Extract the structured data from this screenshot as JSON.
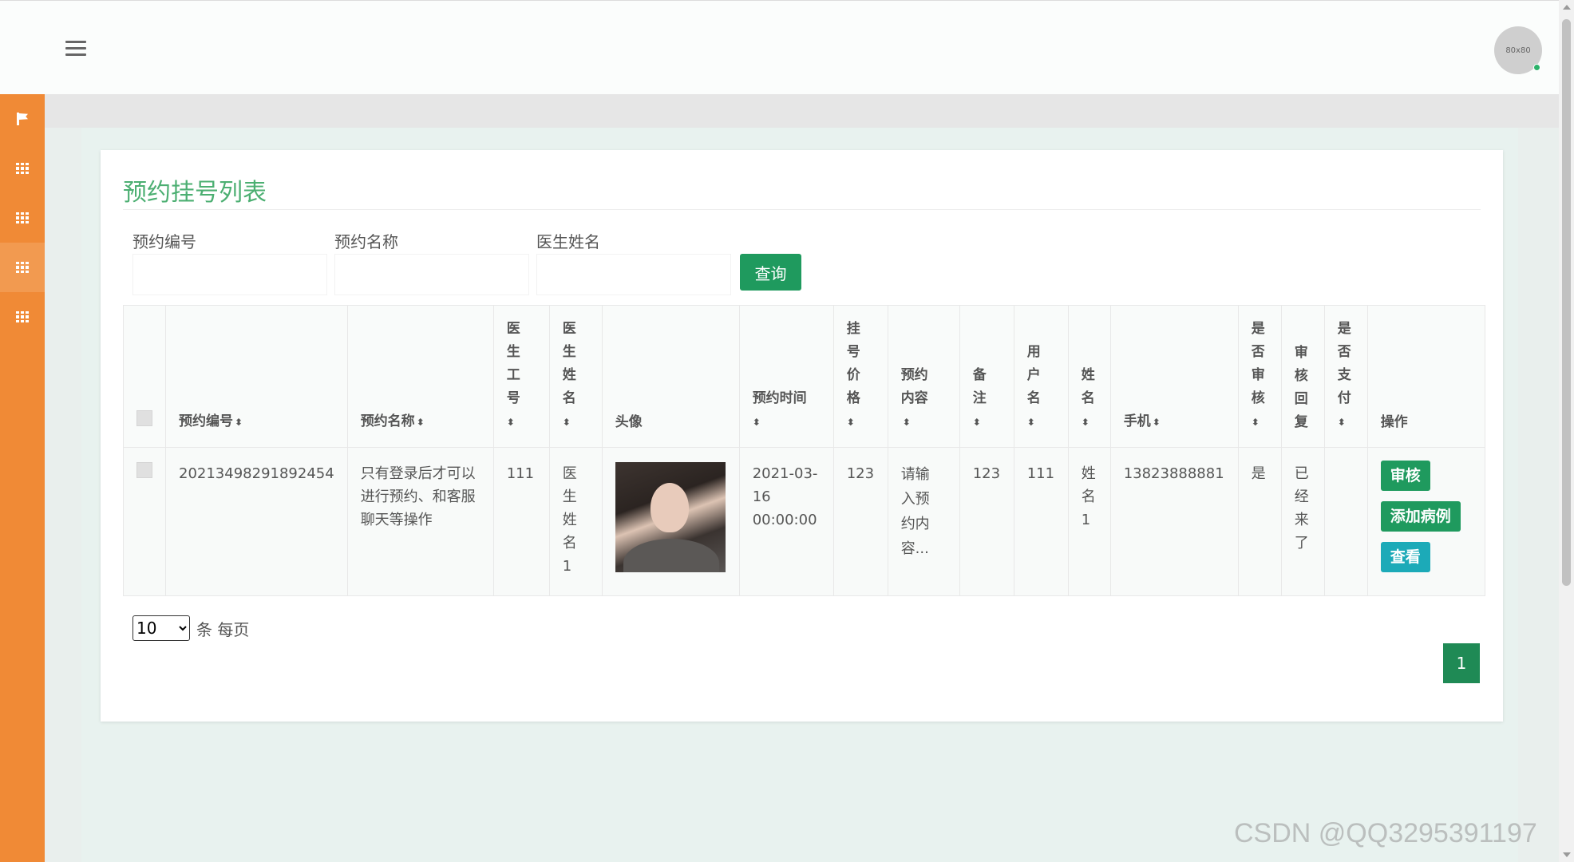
{
  "topbar": {
    "avatar_text": "80x80"
  },
  "sidebar": {
    "items": [
      "flag-icon",
      "grid-icon",
      "grid-icon",
      "grid-icon",
      "grid-icon"
    ],
    "accent": "#f08a36"
  },
  "panel": {
    "title": "预约挂号列表"
  },
  "search": {
    "fields": [
      {
        "label": "预约编号",
        "value": ""
      },
      {
        "label": "预约名称",
        "value": ""
      },
      {
        "label": "医生姓名",
        "value": ""
      }
    ],
    "button": "查询"
  },
  "table": {
    "headers": {
      "h1": "预约编号",
      "h2": "预约名称",
      "h3": "医生工号",
      "h4": "医生姓名",
      "h5": "头像",
      "h6": "预约时间",
      "h7": "挂号价格",
      "h8": "预约内容",
      "h9": "备注",
      "h10": "用户名",
      "h11": "姓名",
      "h12": "手机",
      "h13": "是否审核",
      "h14": "审核回复",
      "h15": "是否支付",
      "h16": "操作"
    },
    "row": {
      "c1": "20213498291892454",
      "c2": "只有登录后才可以进行预约、和客服聊天等操作",
      "c3": "111",
      "c4": "医生姓名1",
      "c6": "2021-03-16 00:00:00",
      "c7": "123",
      "c8": "请输入预约内容...",
      "c9": "123",
      "c10": "111",
      "c11": "姓名1",
      "c12": "13823888881",
      "c13": "是",
      "c14": "已经来了",
      "c15": ""
    },
    "actions": {
      "review": "审核",
      "add_case": "添加病例",
      "view": "查看"
    }
  },
  "pager": {
    "page_size": "10",
    "per_page_label": "条 每页",
    "current_page": "1"
  },
  "watermark": "CSDN @QQ3295391197"
}
